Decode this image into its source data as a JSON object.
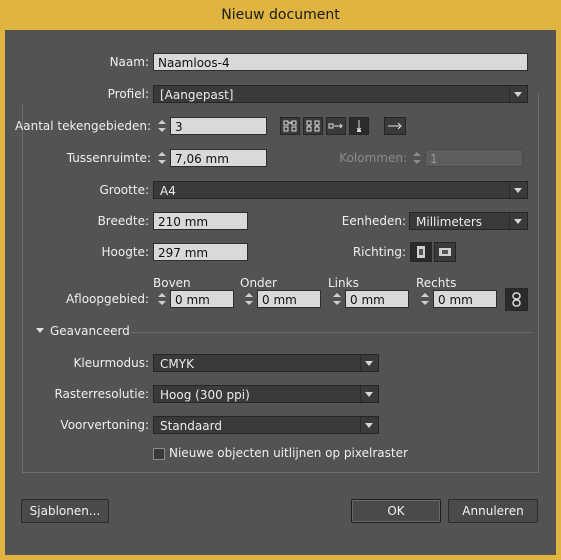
{
  "window": {
    "title": "Nieuw document"
  },
  "form": {
    "naam": {
      "label": "Naam:",
      "value": "Naamloos-4"
    },
    "profiel": {
      "label": "Profiel:",
      "value": "[Aangepast]"
    },
    "tekengebieden": {
      "label": "Aantal tekengebieden:",
      "value": "3"
    },
    "tussenruimte": {
      "label": "Tussenruimte:",
      "value": "7,06 mm"
    },
    "kolommen": {
      "label": "Kolommen:",
      "value": "1"
    },
    "grootte": {
      "label": "Grootte:",
      "value": "A4"
    },
    "breedte": {
      "label": "Breedte:",
      "value": "210 mm"
    },
    "eenheden": {
      "label": "Eenheden:",
      "value": "Millimeters"
    },
    "hoogte": {
      "label": "Hoogte:",
      "value": "297 mm"
    },
    "richting": {
      "label": "Richting:"
    },
    "afloop": {
      "label": "Afloopgebied:",
      "boven": {
        "label": "Boven",
        "value": "0 mm"
      },
      "onder": {
        "label": "Onder",
        "value": "0 mm"
      },
      "links": {
        "label": "Links",
        "value": "0 mm"
      },
      "rechts": {
        "label": "Rechts",
        "value": "0 mm"
      }
    },
    "geavanceerd": {
      "label": "Geavanceerd"
    },
    "kleurmodus": {
      "label": "Kleurmodus:",
      "value": "CMYK"
    },
    "rasterresolutie": {
      "label": "Rasterresolutie:",
      "value": "Hoog (300 ppi)"
    },
    "voorvertoning": {
      "label": "Voorvertoning:",
      "value": "Standaard"
    },
    "uitlijnen": {
      "label": "Nieuwe objecten uitlijnen op pixelraster",
      "checked": false
    }
  },
  "buttons": {
    "sjablonen": "Sjablonen...",
    "ok": "OK",
    "annuleren": "Annuleren"
  },
  "icons": {
    "grid_by_row": "grid-by-row-icon",
    "grid_by_column": "grid-by-column-icon",
    "arrange_by_row": "arrange-by-row-icon",
    "arrange_by_column": "arrange-by-column-icon",
    "direction": "arrow-right-icon",
    "portrait": "portrait-icon",
    "landscape": "landscape-icon",
    "link": "link-chain-icon"
  },
  "colors": {
    "titlebar": "#e0b441",
    "dialog_bg": "#535353"
  }
}
